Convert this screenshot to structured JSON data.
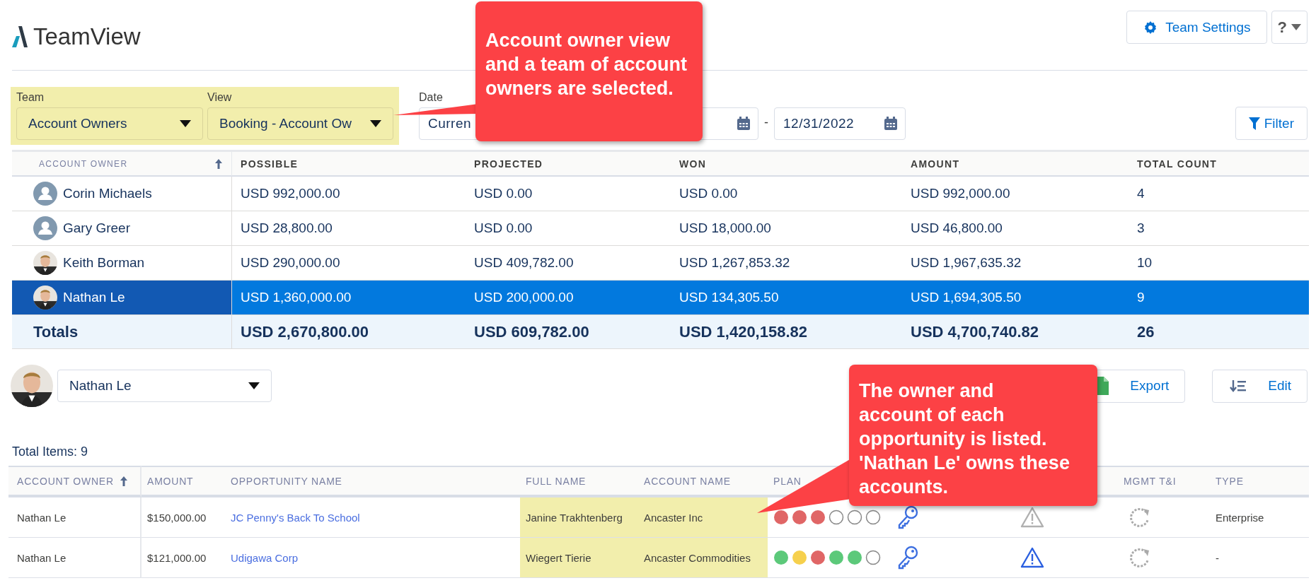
{
  "app": {
    "title": "TeamView"
  },
  "header_buttons": [
    {
      "kind": "settings",
      "label": "Team Settings"
    },
    {
      "kind": "help",
      "label": "?"
    }
  ],
  "filters": {
    "team": {
      "label": "Team",
      "value": "Account Owners"
    },
    "view": {
      "label": "View",
      "value": "Booking - Account Ow"
    },
    "date_range": {
      "label": "Date",
      "start": "Curren",
      "end": "12/31/2022"
    },
    "filter_button": "Filter"
  },
  "summary_table": {
    "columns": [
      {
        "label": "ACCOUNT OWNER",
        "sorted": true
      },
      {
        "label": "POSSIBLE",
        "sorted": false
      },
      {
        "label": "PROJECTED",
        "sorted": false
      },
      {
        "label": "WON",
        "sorted": false
      },
      {
        "label": "AMOUNT",
        "sorted": false
      },
      {
        "label": "TOTAL COUNT",
        "sorted": false
      }
    ],
    "rows": [
      {
        "kind": "generic",
        "selected": false,
        "cells": [
          "Corin Michaels",
          "USD 992,000.00",
          "USD 0.00",
          "USD 0.00",
          "USD 992,000.00",
          "4"
        ]
      },
      {
        "kind": "generic",
        "selected": false,
        "cells": [
          "Gary Greer",
          "USD 28,800.00",
          "USD 0.00",
          "USD 18,000.00",
          "USD 46,800.00",
          "3"
        ]
      },
      {
        "selected": false,
        "cells": [
          "Keith Borman",
          "USD 290,000.00",
          "USD 409,782.00",
          "USD 1,267,853.32",
          "USD 1,967,635.32",
          "10"
        ]
      },
      {
        "selected": true,
        "cells": [
          "Nathan Le",
          "USD 1,360,000.00",
          "USD 200,000.00",
          "USD 134,305.50",
          "USD 1,694,305.50",
          "9"
        ]
      }
    ],
    "totals": {
      "cells": [
        "Totals",
        "USD 2,670,800.00",
        "USD 609,782.00",
        "USD 1,420,158.82",
        "USD 4,700,740.82",
        "26"
      ]
    }
  },
  "owner_selector": {
    "value": "Nathan Le"
  },
  "action_buttons": [
    {
      "kind": "export",
      "label": "Export"
    },
    {
      "kind": "edit",
      "label": "Edit"
    }
  ],
  "total_items": "Total Items: 9",
  "detail_table": {
    "columns": [
      {
        "label": "ACCOUNT OWNER",
        "sorted": true
      },
      {
        "label": "AMOUNT",
        "sorted": false
      },
      {
        "label": "OPPORTUNITY NAME",
        "sorted": false
      },
      {
        "label": "FULL NAME",
        "sorted": false
      },
      {
        "label": "ACCOUNT NAME",
        "sorted": false
      },
      {
        "label": "PLAN",
        "sorted": false
      },
      {
        "label": "MGMT T&I",
        "sorted": false
      },
      {
        "label": "TYPE",
        "sorted": false
      }
    ],
    "rows": [
      {
        "owner": "Nathan Le",
        "amount": "$150,000.00",
        "opportunity": "JC Penny's Back To School",
        "full_name": "Janine Trakhtenberg",
        "account": "Ancaster Inc",
        "plan": [
          {
            "filled": true,
            "color": "#e06666"
          },
          {
            "filled": true,
            "color": "#e06666"
          },
          {
            "filled": true,
            "color": "#e06666"
          },
          {
            "filled": false
          },
          {
            "filled": false
          },
          {
            "filled": false
          }
        ],
        "alert_active": false,
        "type": "Enterprise"
      },
      {
        "owner": "Nathan Le",
        "amount": "$121,000.00",
        "opportunity": "Udigawa Corp",
        "full_name": "Wiegert Tierie",
        "account": "Ancaster Commodities",
        "plan": [
          {
            "filled": true,
            "color": "#5cc97a"
          },
          {
            "filled": true,
            "color": "#f6d04d"
          },
          {
            "filled": true,
            "color": "#e06666"
          },
          {
            "filled": true,
            "color": "#5cc97a"
          },
          {
            "filled": true,
            "color": "#5cc97a"
          },
          {
            "filled": false
          }
        ],
        "alert_active": true,
        "type": "-"
      }
    ]
  },
  "callouts": [
    {
      "text": "Account owner view and a team of account owners are selected."
    },
    {
      "text": "The owner and account of each opportunity is listed. 'Nathan Le' owns these accounts."
    }
  ]
}
